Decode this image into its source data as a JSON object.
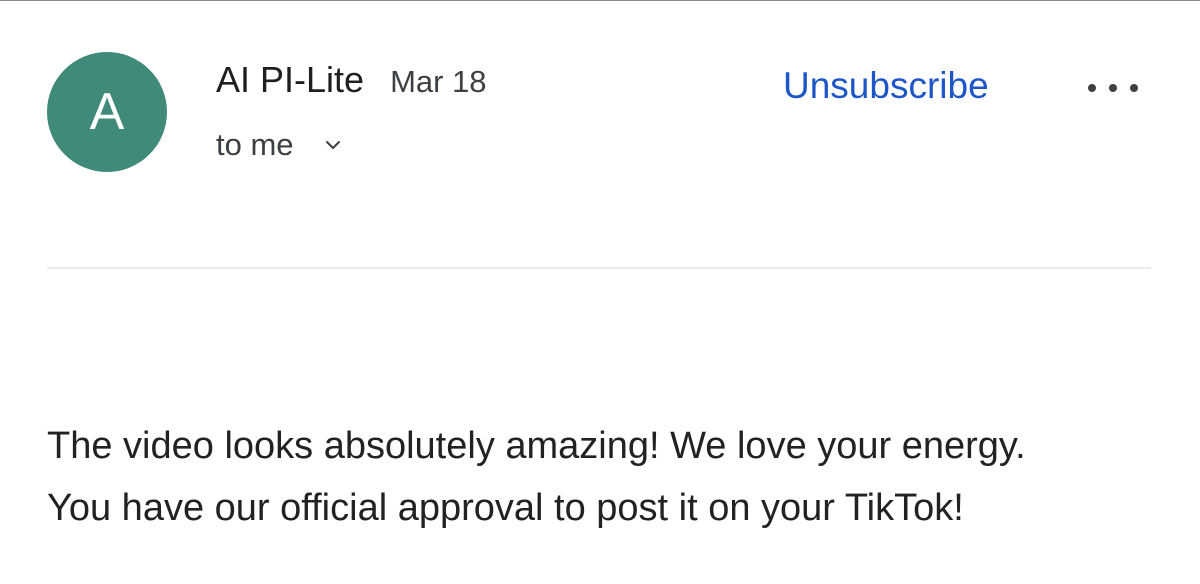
{
  "message": {
    "sender": {
      "avatar_letter": "A",
      "avatar_color": "#3f8a78",
      "name": "AI PI-Lite"
    },
    "date": "Mar 18",
    "recipient": "to me",
    "actions": {
      "unsubscribe_label": "Unsubscribe",
      "more_icon": "more-horizontal-icon",
      "expand_icon": "chevron-down-icon"
    },
    "body": [
      "The video looks absolutely amazing! We love your energy.",
      "You have our official approval to post it on your TikTok!"
    ]
  },
  "colors": {
    "link": "#1d56c9",
    "text": "#222222",
    "muted": "#3c4043",
    "divider": "#ececec"
  }
}
